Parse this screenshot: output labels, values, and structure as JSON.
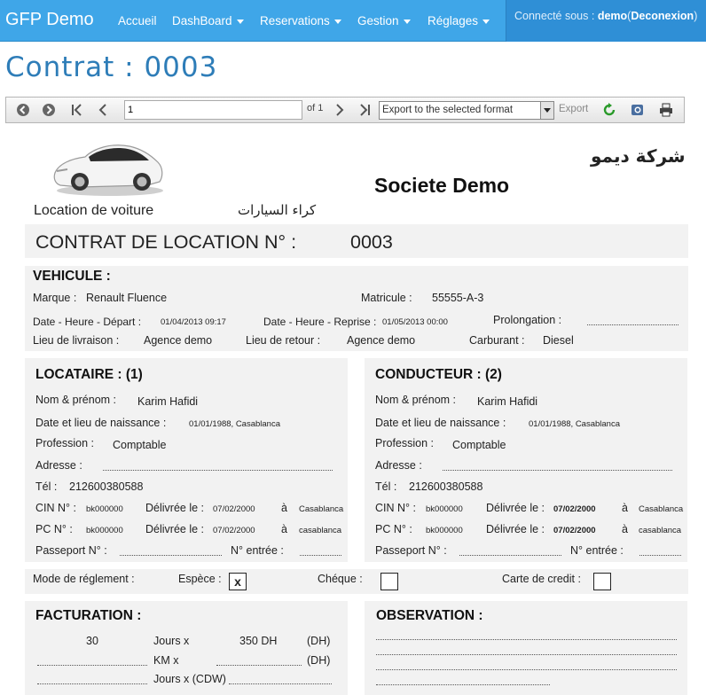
{
  "navbar": {
    "brand": "GFP Demo",
    "items": [
      "Accueil",
      "DashBoard",
      "Reservations",
      "Gestion",
      "Réglages"
    ],
    "connected_label": "Connecté sous :",
    "username": "demo",
    "logout": "Deconexion",
    "color": "#3fa6e8"
  },
  "page_title": "Contrat : 0003",
  "toolbar": {
    "page_value": "1",
    "page_of": "of 1",
    "export_format": "Export to the selected format",
    "export_label": "Export",
    "icons": [
      "back-icon",
      "forward-icon",
      "first-page-icon",
      "prev-page-icon",
      "next-page-icon",
      "last-page-icon",
      "refresh-icon",
      "zoom-icon",
      "print-icon"
    ]
  },
  "report": {
    "company_arabic": "شركة ديمو",
    "company_name": "Societe Demo",
    "tagline": "Location de voiture",
    "tagline_arabic": "كراء السيارات",
    "contract_title": "CONTRAT DE LOCATION N° :",
    "contract_number": "0003",
    "vehicule": {
      "title": "VEHICULE :",
      "marque_label": "Marque :",
      "marque": "Renault Fluence",
      "matricule_label": "Matricule :",
      "matricule": "55555-A-3",
      "depart_label": "Date - Heure - Départ :",
      "depart": "01/04/2013 09:17",
      "reprise_label": "Date - Heure - Reprise :",
      "reprise": "01/05/2013 00:00",
      "prolongation_label": "Prolongation :",
      "livraison_label": "Lieu de livraison :",
      "livraison": "Agence demo",
      "retour_label": "Lieu de retour :",
      "retour": "Agence demo",
      "carburant_label": "Carburant :",
      "carburant": "Diesel"
    },
    "locataire": {
      "title": "LOCATAIRE : (1)",
      "nom_label": "Nom & prénom :",
      "nom": "Karim Hafidi",
      "naissance_label": "Date et lieu de naissance :",
      "naissance": "01/01/1988, Casablanca",
      "profession_label": "Profession :",
      "profession": "Comptable",
      "adresse_label": "Adresse :",
      "tel_label": "Tél :",
      "tel": "212600380588",
      "cin_label": "CIN N° :",
      "cin": "bk000000",
      "cin_delivre_label": "Délivrée le :",
      "cin_delivre": "07/02/2000",
      "a_label": "à",
      "cin_lieu": "Casablanca",
      "pc_label": "PC N° :",
      "pc": "bk000000",
      "pc_delivre_label": "Délivrée le :",
      "pc_delivre": "07/02/2000",
      "pc_lieu": "casablanca",
      "passeport_label": "Passeport N° :",
      "entree_label": "N° entrée :"
    },
    "conducteur": {
      "title": "CONDUCTEUR : (2)",
      "nom_label": "Nom & prénom :",
      "nom": "Karim Hafidi",
      "naissance_label": "Date et lieu de naissance :",
      "naissance": "01/01/1988, Casablanca",
      "profession_label": "Profession :",
      "profession": "Comptable",
      "adresse_label": "Adresse :",
      "tel_label": "Tél :",
      "tel": "212600380588",
      "cin_label": "CIN N° :",
      "cin": "bk000000",
      "cin_delivre_label": "Délivrée le :",
      "cin_delivre": "07/02/2000",
      "a_label": "à",
      "cin_lieu": "Casablanca",
      "pc_label": "PC N° :",
      "pc": "bk000000",
      "pc_delivre_label": "Délivrée le :",
      "pc_delivre": "07/02/2000",
      "pc_lieu": "casablanca",
      "passeport_label": "Passeport N° :",
      "entree_label": "N° entrée :"
    },
    "reglement": {
      "mode_label": "Mode de réglement :",
      "espece_label": "Espèce :",
      "espece_mark": "x",
      "cheque_label": "Chéque :",
      "carte_label": "Carte de credit :"
    },
    "facturation": {
      "title": "FACTURATION :",
      "jours_value": "30",
      "jours_label": "Jours x",
      "jours_price": "350 DH",
      "dh_label": "(DH)",
      "km_label": "KM x",
      "cdw_label": "Jours x (CDW)"
    },
    "observation": {
      "title": "OBSERVATION :"
    }
  }
}
